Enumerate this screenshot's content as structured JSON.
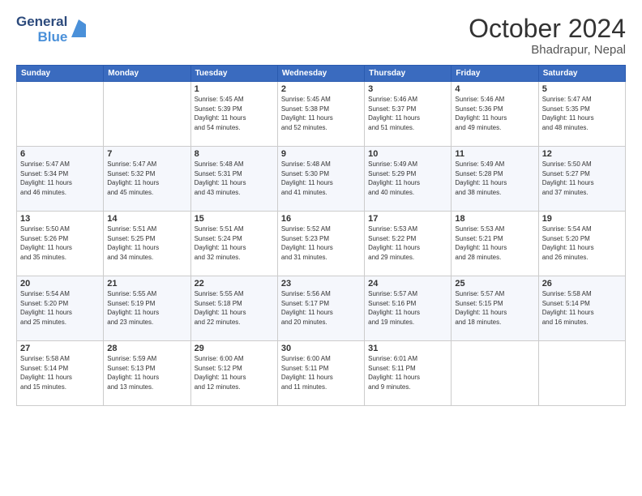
{
  "logo": {
    "line1": "General",
    "line2": "Blue"
  },
  "header": {
    "month": "October 2024",
    "location": "Bhadrapur, Nepal"
  },
  "weekdays": [
    "Sunday",
    "Monday",
    "Tuesday",
    "Wednesday",
    "Thursday",
    "Friday",
    "Saturday"
  ],
  "weeks": [
    [
      {
        "day": "",
        "info": ""
      },
      {
        "day": "",
        "info": ""
      },
      {
        "day": "1",
        "info": "Sunrise: 5:45 AM\nSunset: 5:39 PM\nDaylight: 11 hours\nand 54 minutes."
      },
      {
        "day": "2",
        "info": "Sunrise: 5:45 AM\nSunset: 5:38 PM\nDaylight: 11 hours\nand 52 minutes."
      },
      {
        "day": "3",
        "info": "Sunrise: 5:46 AM\nSunset: 5:37 PM\nDaylight: 11 hours\nand 51 minutes."
      },
      {
        "day": "4",
        "info": "Sunrise: 5:46 AM\nSunset: 5:36 PM\nDaylight: 11 hours\nand 49 minutes."
      },
      {
        "day": "5",
        "info": "Sunrise: 5:47 AM\nSunset: 5:35 PM\nDaylight: 11 hours\nand 48 minutes."
      }
    ],
    [
      {
        "day": "6",
        "info": "Sunrise: 5:47 AM\nSunset: 5:34 PM\nDaylight: 11 hours\nand 46 minutes."
      },
      {
        "day": "7",
        "info": "Sunrise: 5:47 AM\nSunset: 5:32 PM\nDaylight: 11 hours\nand 45 minutes."
      },
      {
        "day": "8",
        "info": "Sunrise: 5:48 AM\nSunset: 5:31 PM\nDaylight: 11 hours\nand 43 minutes."
      },
      {
        "day": "9",
        "info": "Sunrise: 5:48 AM\nSunset: 5:30 PM\nDaylight: 11 hours\nand 41 minutes."
      },
      {
        "day": "10",
        "info": "Sunrise: 5:49 AM\nSunset: 5:29 PM\nDaylight: 11 hours\nand 40 minutes."
      },
      {
        "day": "11",
        "info": "Sunrise: 5:49 AM\nSunset: 5:28 PM\nDaylight: 11 hours\nand 38 minutes."
      },
      {
        "day": "12",
        "info": "Sunrise: 5:50 AM\nSunset: 5:27 PM\nDaylight: 11 hours\nand 37 minutes."
      }
    ],
    [
      {
        "day": "13",
        "info": "Sunrise: 5:50 AM\nSunset: 5:26 PM\nDaylight: 11 hours\nand 35 minutes."
      },
      {
        "day": "14",
        "info": "Sunrise: 5:51 AM\nSunset: 5:25 PM\nDaylight: 11 hours\nand 34 minutes."
      },
      {
        "day": "15",
        "info": "Sunrise: 5:51 AM\nSunset: 5:24 PM\nDaylight: 11 hours\nand 32 minutes."
      },
      {
        "day": "16",
        "info": "Sunrise: 5:52 AM\nSunset: 5:23 PM\nDaylight: 11 hours\nand 31 minutes."
      },
      {
        "day": "17",
        "info": "Sunrise: 5:53 AM\nSunset: 5:22 PM\nDaylight: 11 hours\nand 29 minutes."
      },
      {
        "day": "18",
        "info": "Sunrise: 5:53 AM\nSunset: 5:21 PM\nDaylight: 11 hours\nand 28 minutes."
      },
      {
        "day": "19",
        "info": "Sunrise: 5:54 AM\nSunset: 5:20 PM\nDaylight: 11 hours\nand 26 minutes."
      }
    ],
    [
      {
        "day": "20",
        "info": "Sunrise: 5:54 AM\nSunset: 5:20 PM\nDaylight: 11 hours\nand 25 minutes."
      },
      {
        "day": "21",
        "info": "Sunrise: 5:55 AM\nSunset: 5:19 PM\nDaylight: 11 hours\nand 23 minutes."
      },
      {
        "day": "22",
        "info": "Sunrise: 5:55 AM\nSunset: 5:18 PM\nDaylight: 11 hours\nand 22 minutes."
      },
      {
        "day": "23",
        "info": "Sunrise: 5:56 AM\nSunset: 5:17 PM\nDaylight: 11 hours\nand 20 minutes."
      },
      {
        "day": "24",
        "info": "Sunrise: 5:57 AM\nSunset: 5:16 PM\nDaylight: 11 hours\nand 19 minutes."
      },
      {
        "day": "25",
        "info": "Sunrise: 5:57 AM\nSunset: 5:15 PM\nDaylight: 11 hours\nand 18 minutes."
      },
      {
        "day": "26",
        "info": "Sunrise: 5:58 AM\nSunset: 5:14 PM\nDaylight: 11 hours\nand 16 minutes."
      }
    ],
    [
      {
        "day": "27",
        "info": "Sunrise: 5:58 AM\nSunset: 5:14 PM\nDaylight: 11 hours\nand 15 minutes."
      },
      {
        "day": "28",
        "info": "Sunrise: 5:59 AM\nSunset: 5:13 PM\nDaylight: 11 hours\nand 13 minutes."
      },
      {
        "day": "29",
        "info": "Sunrise: 6:00 AM\nSunset: 5:12 PM\nDaylight: 11 hours\nand 12 minutes."
      },
      {
        "day": "30",
        "info": "Sunrise: 6:00 AM\nSunset: 5:11 PM\nDaylight: 11 hours\nand 11 minutes."
      },
      {
        "day": "31",
        "info": "Sunrise: 6:01 AM\nSunset: 5:11 PM\nDaylight: 11 hours\nand 9 minutes."
      },
      {
        "day": "",
        "info": ""
      },
      {
        "day": "",
        "info": ""
      }
    ]
  ]
}
